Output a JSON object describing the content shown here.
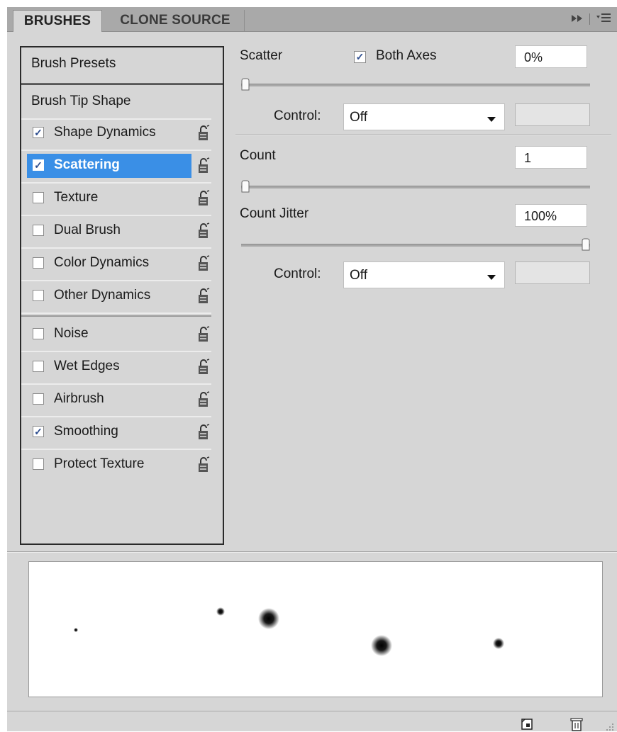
{
  "tabs": [
    {
      "label": "BRUSHES",
      "active": true
    },
    {
      "label": "CLONE SOURCE",
      "active": false
    }
  ],
  "tab_icons": [
    "fast-forward-icon",
    "panel-menu-icon"
  ],
  "left_panel": {
    "presets_label": "Brush Presets",
    "tip_shape_label": "Brush Tip Shape",
    "group1": [
      {
        "label": "Shape Dynamics",
        "checked": true
      },
      {
        "label": "Scattering",
        "checked": true,
        "selected": true
      },
      {
        "label": "Texture",
        "checked": false
      },
      {
        "label": "Dual Brush",
        "checked": false
      },
      {
        "label": "Color Dynamics",
        "checked": false
      },
      {
        "label": "Other Dynamics",
        "checked": false
      }
    ],
    "group2": [
      {
        "label": "Noise",
        "checked": false
      },
      {
        "label": "Wet Edges",
        "checked": false
      },
      {
        "label": "Airbrush",
        "checked": false
      },
      {
        "label": "Smoothing",
        "checked": true
      },
      {
        "label": "Protect Texture",
        "checked": false
      }
    ],
    "lock_icon": "lock-icon"
  },
  "scatter": {
    "label": "Scatter",
    "both_axes_label": "Both Axes",
    "both_axes_checked": true,
    "value": "0%",
    "slider_fraction": 0.0,
    "control_label": "Control:",
    "control_value": "Off"
  },
  "count": {
    "label": "Count",
    "value": "1",
    "slider_fraction": 0.0
  },
  "count_jitter": {
    "label": "Count Jitter",
    "value": "100%",
    "slider_fraction": 1.0,
    "control_label": "Control:",
    "control_value": "Off"
  },
  "check_mark": "✓",
  "bottom_icons": [
    "new-preset-icon",
    "trash-icon"
  ]
}
